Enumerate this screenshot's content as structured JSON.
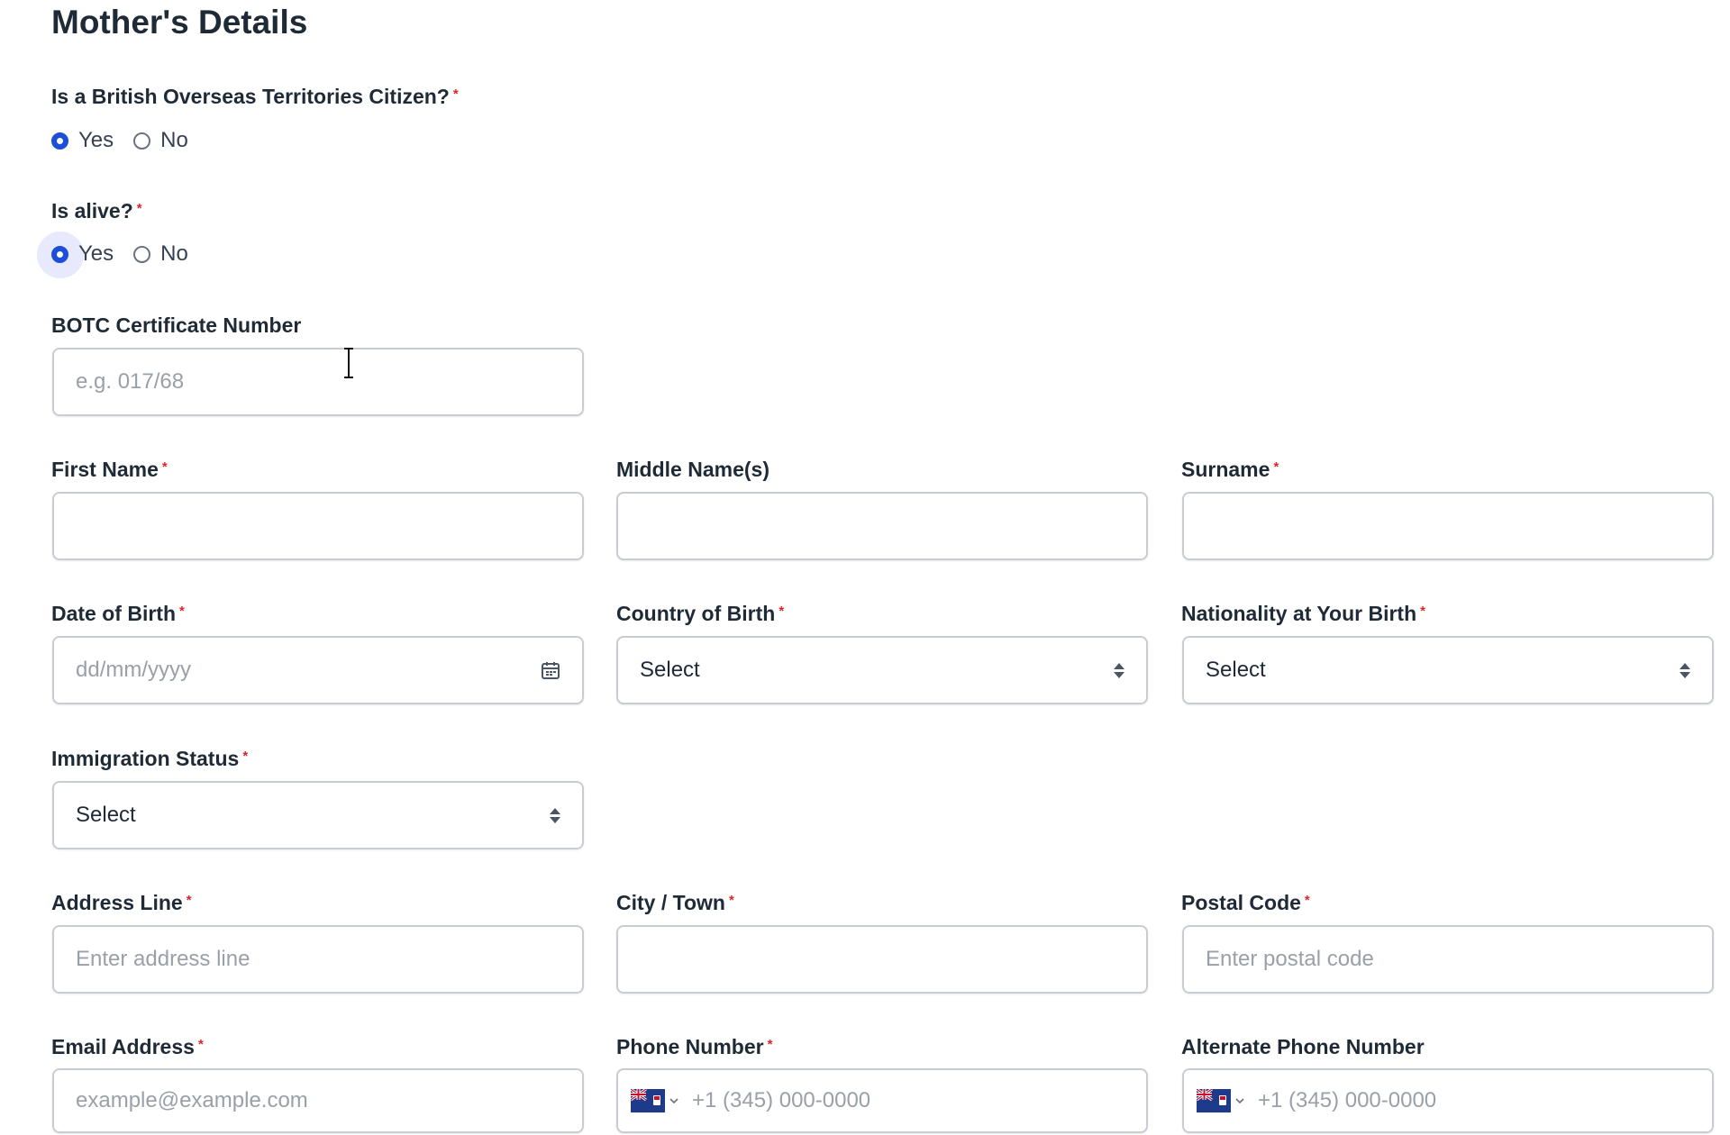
{
  "section_title": "Mother's Details",
  "required_mark": "*",
  "botc_citizen": {
    "label": "Is a British Overseas Territories Citizen?",
    "options": [
      "Yes",
      "No"
    ],
    "selected": "Yes"
  },
  "is_alive": {
    "label": "Is alive?",
    "options": [
      "Yes",
      "No"
    ],
    "selected": "Yes"
  },
  "botc_certificate": {
    "label": "BOTC Certificate Number",
    "placeholder": "e.g. 017/68",
    "value": ""
  },
  "first_name": {
    "label": "First Name",
    "value": ""
  },
  "middle_name": {
    "label": "Middle Name(s)",
    "value": ""
  },
  "surname": {
    "label": "Surname",
    "value": ""
  },
  "date_of_birth": {
    "label": "Date of Birth",
    "placeholder": "dd/mm/yyyy",
    "icon": "calendar-icon"
  },
  "country_of_birth": {
    "label": "Country of Birth",
    "selected": "Select"
  },
  "nationality_at_birth": {
    "label": "Nationality at Your Birth",
    "selected": "Select"
  },
  "immigration_status": {
    "label": "Immigration Status",
    "selected": "Select"
  },
  "address_line": {
    "label": "Address Line",
    "placeholder": "Enter address line"
  },
  "city_town": {
    "label": "City / Town",
    "value": ""
  },
  "postal_code": {
    "label": "Postal Code",
    "placeholder": "Enter postal code"
  },
  "email": {
    "label": "Email Address",
    "placeholder": "example@example.com"
  },
  "phone": {
    "label": "Phone Number",
    "placeholder": "+1 (345) 000-0000",
    "flag": "cayman-islands-flag-icon"
  },
  "alt_phone": {
    "label": "Alternate Phone Number",
    "placeholder": "+1 (345) 000-0000",
    "flag": "cayman-islands-flag-icon"
  },
  "colors": {
    "accent": "#1d4ed8",
    "required": "#dc2626",
    "border": "#c9cdd3",
    "placeholder": "#9aa0a8"
  }
}
